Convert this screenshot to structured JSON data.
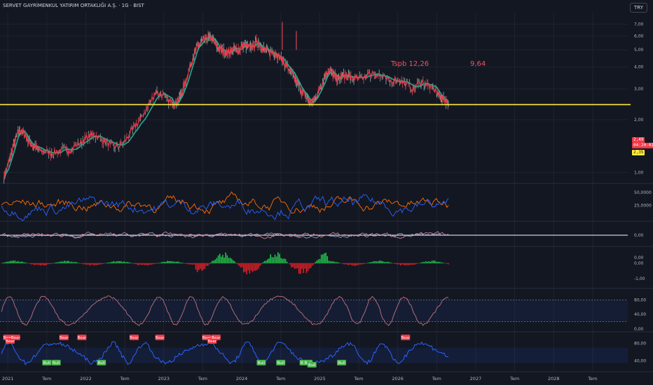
{
  "header": {
    "symbol_title": "SERVET GAYRİMENKUL YATIRIM ORTAKLIĞI A.Ş. · 1G · BIST",
    "currency_button": "TRY"
  },
  "annotations": {
    "note_left": "Tspb  12,26",
    "note_right": "9,64"
  },
  "price_labels": {
    "last_price": "2,49",
    "countdown": "04:20:02",
    "horizontal_level": "2,35"
  },
  "colors": {
    "background": "#131722",
    "grid": "#1f2330",
    "price_line": "#f23645",
    "ma_line": "#22ab94",
    "candles_mixed": "#ff8a8a",
    "horizontal_level": "#ffeb3b",
    "osc_blue": "#2962ff",
    "osc_orange": "#ff6d00",
    "hist_green": "#22c14a",
    "hist_red": "#e01f26",
    "rsi_line": "#b26a7a",
    "blue_osc": "#2962ff",
    "bear_label": "#f23645",
    "bull_label": "#4caf50"
  },
  "chart_data": {
    "type": "line",
    "y_scale": "log",
    "x_axis": {
      "tick_labels": [
        "2021",
        "Tem",
        "2022",
        "Tem",
        "2023",
        "Tem",
        "2024",
        "Tem",
        "2025",
        "Tem",
        "2026",
        "Tem",
        "2027",
        "Tem",
        "2028",
        "Tem"
      ]
    },
    "main_pane": {
      "ylim": [
        0.9,
        8
      ],
      "y_tick_labels": [
        "7,00",
        "6,00",
        "5,00",
        "4,00",
        "3,00",
        "2,00",
        "1,00"
      ],
      "y_tick_values": [
        7,
        6,
        5,
        4,
        3,
        2,
        1
      ],
      "series": [
        {
          "x": [
            2020.95,
            2021.0,
            2021.05,
            2021.1,
            2021.15,
            2021.2,
            2021.25,
            2021.3,
            2021.35,
            2021.4,
            2021.5,
            2021.6,
            2021.7,
            2021.8,
            2021.9,
            2022.0,
            2022.1,
            2022.2,
            2022.3,
            2022.4,
            2022.5,
            2022.6,
            2022.7,
            2022.8,
            2022.9,
            2023.0,
            2023.1,
            2023.15,
            2023.2,
            2023.25,
            2023.3,
            2023.35,
            2023.4,
            2023.45,
            2023.5,
            2023.55,
            2023.6,
            2023.65,
            2023.7,
            2023.75,
            2023.8,
            2023.85,
            2023.9,
            2023.95,
            2024.0,
            2024.05,
            2024.1,
            2024.15,
            2024.2,
            2024.25,
            2024.3,
            2024.35,
            2024.4,
            2024.45,
            2024.5,
            2024.55,
            2024.6,
            2024.65,
            2024.7,
            2024.75,
            2024.8,
            2024.85,
            2024.9,
            2024.95,
            2025.0,
            2025.05,
            2025.1,
            2025.15,
            2025.2,
            2025.25,
            2025.3,
            2025.35,
            2025.4,
            2025.5,
            2025.6,
            2025.7,
            2025.8,
            2025.9,
            2026.0,
            2026.1,
            2026.2,
            2026.3,
            2026.4,
            2026.5,
            2026.55,
            2026.6,
            2026.65
          ],
          "y": [
            0.95,
            1.1,
            1.3,
            1.55,
            1.75,
            1.7,
            1.55,
            1.45,
            1.4,
            1.35,
            1.3,
            1.3,
            1.35,
            1.35,
            1.45,
            1.55,
            1.65,
            1.55,
            1.45,
            1.4,
            1.5,
            1.75,
            2.0,
            2.4,
            2.9,
            2.7,
            2.5,
            2.5,
            2.65,
            3.0,
            3.5,
            4.2,
            4.9,
            5.3,
            5.6,
            5.85,
            5.9,
            5.5,
            5.1,
            5.0,
            4.8,
            4.9,
            5.1,
            5.0,
            5.2,
            5.3,
            5.1,
            5.3,
            5.6,
            5.2,
            5.0,
            4.8,
            4.9,
            4.7,
            4.5,
            4.2,
            3.9,
            3.6,
            3.3,
            3.0,
            2.8,
            2.6,
            2.5,
            2.7,
            3.0,
            3.4,
            3.8,
            3.7,
            3.5,
            3.4,
            3.6,
            3.5,
            3.5,
            3.4,
            3.6,
            3.7,
            3.5,
            3.3,
            3.4,
            3.2,
            3.0,
            3.3,
            3.1,
            2.9,
            2.7,
            2.6,
            2.49
          ],
          "name": ""
        }
      ],
      "horizontal_line": 2.35
    },
    "osc1_pane": {
      "y_tick_labels": [
        "50,0000",
        "25,0000"
      ],
      "y_tick_values": [
        50,
        25
      ],
      "ylim": [
        0,
        62
      ]
    },
    "osc2_pane": {
      "y_tick_labels": [
        "0,00"
      ],
      "y_tick_values": [
        0
      ]
    },
    "histogram_pane": {
      "y_tick_labels": [
        "0,00",
        "0,00",
        "-1,00"
      ],
      "y_tick_values": [
        0.35,
        0,
        -1
      ],
      "ylim": [
        -1.45,
        0.8
      ]
    },
    "rsi_pane": {
      "y_tick_labels": [
        "80,00",
        "40,00",
        "0,00"
      ],
      "y_tick_values": [
        80,
        40,
        0
      ],
      "ylim": [
        0,
        100
      ],
      "bands": [
        80,
        20
      ]
    },
    "bull_bear_pane": {
      "y_tick_labels": [
        "80,00",
        "40,00"
      ],
      "y_tick_values": [
        80,
        40
      ],
      "ylim": [
        20,
        100
      ],
      "signals": [
        {
          "x": 2021.0,
          "text": "Bear",
          "kind": "bear"
        },
        {
          "x": 2021.03,
          "text": "Bear",
          "kind": "bear"
        },
        {
          "x": 2021.1,
          "text": "Bear",
          "kind": "bear"
        },
        {
          "x": 2021.5,
          "text": "Bull",
          "kind": "bull"
        },
        {
          "x": 2021.62,
          "text": "Bull",
          "kind": "bull"
        },
        {
          "x": 2021.72,
          "text": "Bear",
          "kind": "bear"
        },
        {
          "x": 2021.95,
          "text": "Bear",
          "kind": "bear"
        },
        {
          "x": 2022.2,
          "text": "Bull",
          "kind": "bull"
        },
        {
          "x": 2022.62,
          "text": "Bear",
          "kind": "bear"
        },
        {
          "x": 2022.95,
          "text": "Bear",
          "kind": "bear"
        },
        {
          "x": 2023.55,
          "text": "Bear",
          "kind": "bear"
        },
        {
          "x": 2023.62,
          "text": "Bear",
          "kind": "bear"
        },
        {
          "x": 2023.67,
          "text": "Bear",
          "kind": "bear"
        },
        {
          "x": 2024.25,
          "text": "Bull",
          "kind": "bull"
        },
        {
          "x": 2024.5,
          "text": "Bull",
          "kind": "bull"
        },
        {
          "x": 2024.8,
          "text": "Bull",
          "kind": "bull"
        },
        {
          "x": 2024.85,
          "text": "Bull",
          "kind": "bull"
        },
        {
          "x": 2024.9,
          "text": "Bull",
          "kind": "bull"
        },
        {
          "x": 2025.28,
          "text": "Bull",
          "kind": "bull"
        },
        {
          "x": 2026.1,
          "text": "Bear",
          "kind": "bear"
        }
      ]
    }
  }
}
